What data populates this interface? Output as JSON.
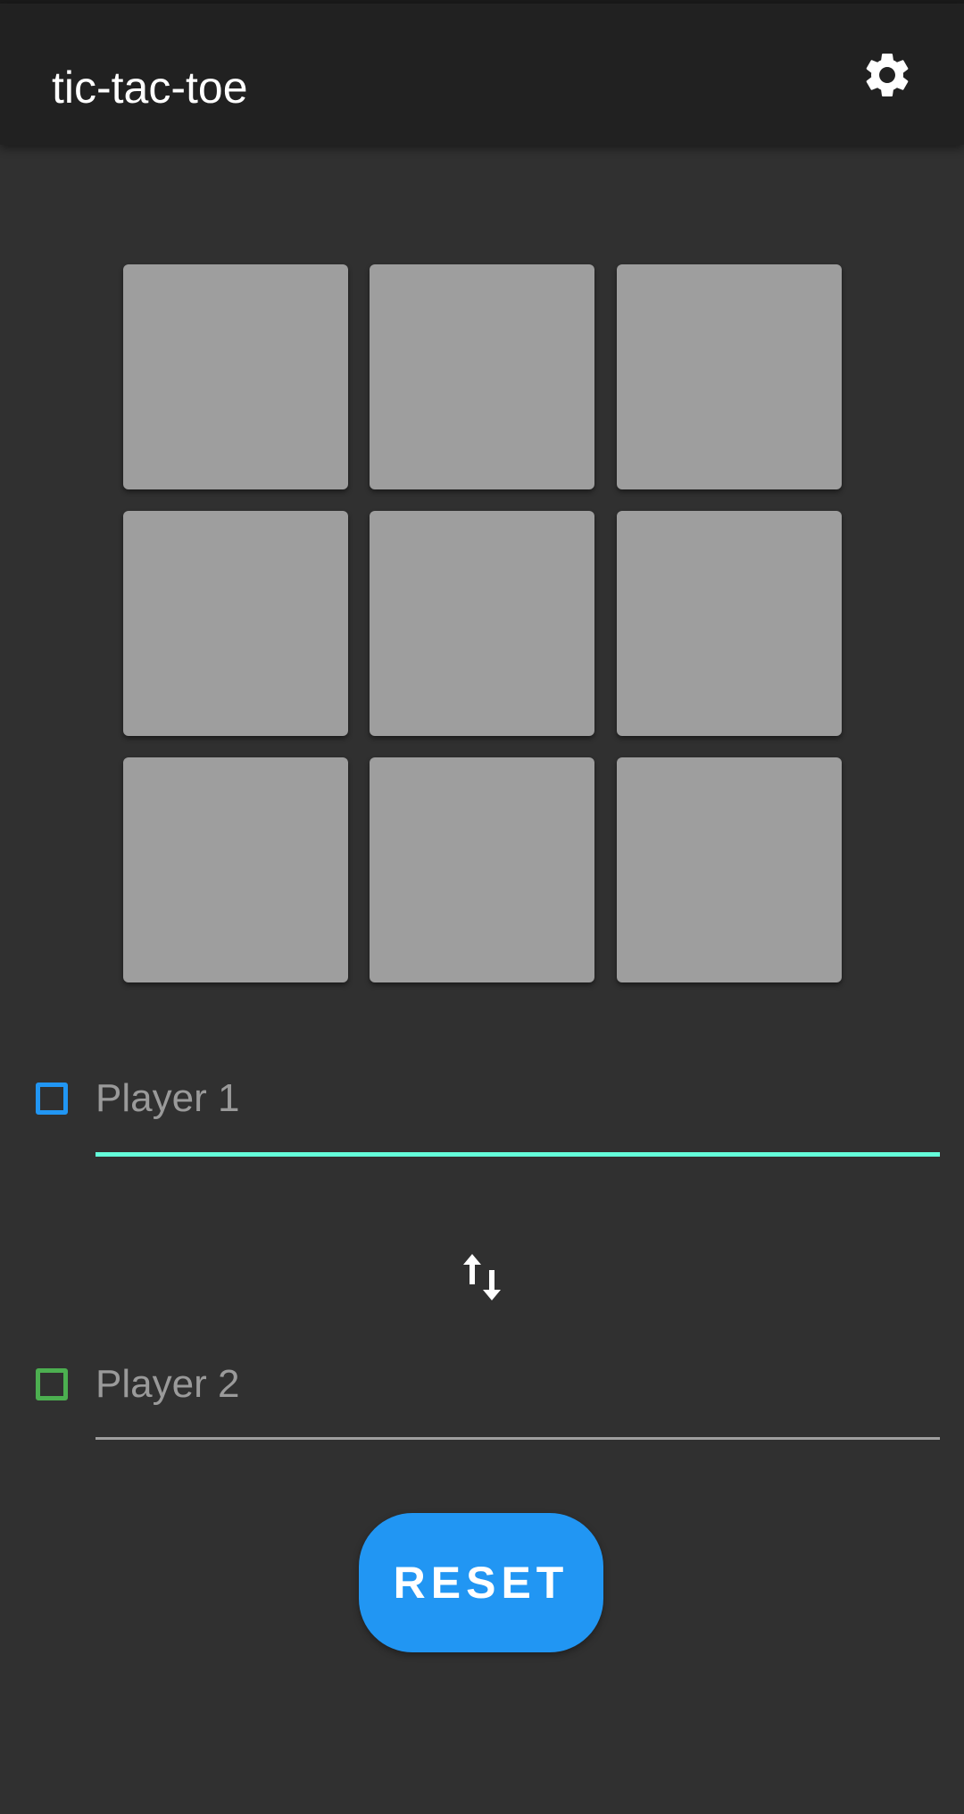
{
  "app_bar": {
    "title": "tic-tac-toe",
    "settings_icon": "gear-icon"
  },
  "board": {
    "cells": [
      "",
      "",
      "",
      "",
      "",
      "",
      "",
      "",
      ""
    ]
  },
  "players": [
    {
      "placeholder": "Player 1",
      "value": "",
      "color": "#2196f3",
      "focused": true,
      "underline_color": "#64ffda"
    },
    {
      "placeholder": "Player 2",
      "value": "",
      "color": "#4caf50",
      "focused": false,
      "underline_color": "#9e9e9e"
    }
  ],
  "swap": {
    "icon": "swap-vertical-icon"
  },
  "reset": {
    "label": "RESET",
    "color": "#2196f3"
  }
}
